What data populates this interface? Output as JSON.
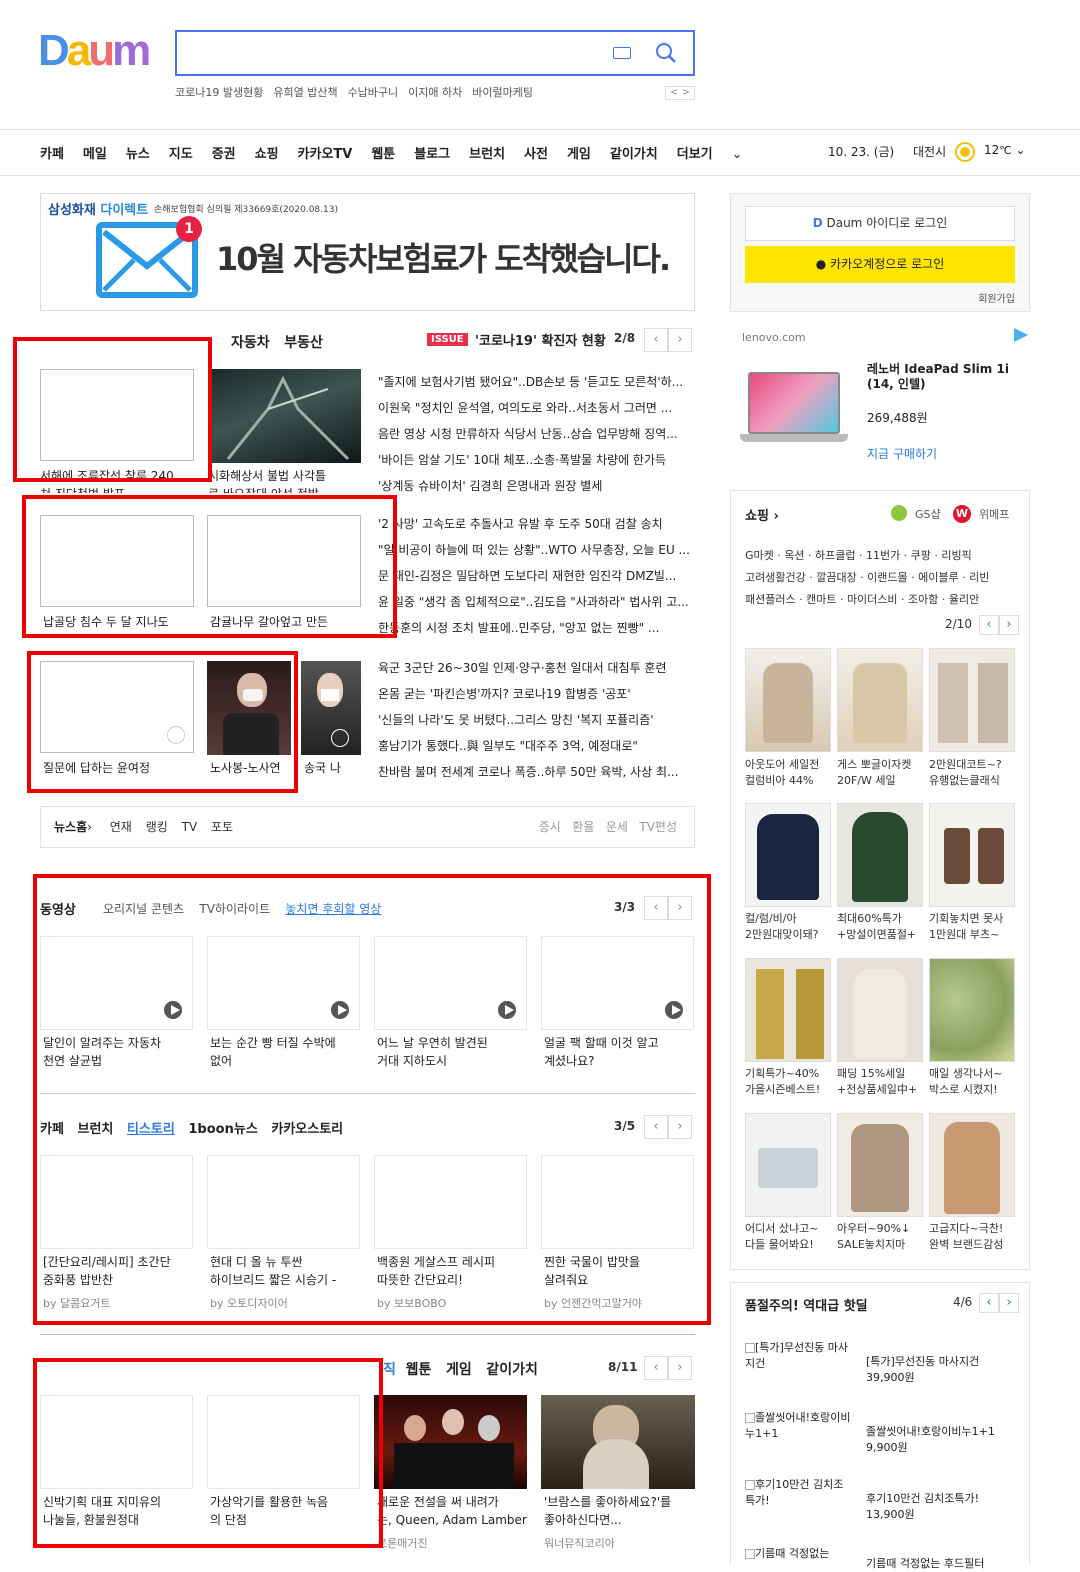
{
  "logo": "Daum",
  "header": {
    "keyword_icon": "keyboard-icon",
    "search_icon": "search-icon",
    "hot_keywords": [
      "코로나19 발생현황",
      "유희열 밥산책",
      "수납바구니",
      "이지애 하차",
      "바이럴마케팅"
    ],
    "pager_prev": "<",
    "pager_next": ">"
  },
  "nav": {
    "items": [
      "카페",
      "메일",
      "뉴스",
      "지도",
      "증권",
      "쇼핑",
      "카카오TV",
      "웹툰",
      "블로그",
      "브런치",
      "사전",
      "게임",
      "같이가치",
      "더보기"
    ],
    "date": "10. 23. (금)",
    "location": "대전시",
    "temp": "12",
    "temp_unit": "℃"
  },
  "ad": {
    "brand1": "삼성화재",
    "brand2": "다이렉트",
    "note": "손해보험협회 심의필 제33669호(2020.08.13)",
    "badge": "1",
    "headline": "10월 자동차보험료가 도착했습니다."
  },
  "news": {
    "tabs_partial": "자동차",
    "tab2": "부동산",
    "issue_badge": "ISSUE",
    "issue_text": "'코로나19' 확진자 현황",
    "issue_page": "2/8",
    "row1_caps": [
      "서해에 조류잡선 참루 240",
      "쳐 진단청법 발표",
      "시화해상서 불법 사각틀",
      "로 바오장대 야선 적발"
    ],
    "row2_caps": [
      "납골당 침수 두 달 지나도",
      "감귤나무 갈아엎고 만든"
    ],
    "row3_caps": [
      "질문에 답하는 윤여정",
      "노사봉-노사연",
      "송국 나"
    ],
    "list": [
      "\"졸지에 보험사기범 됐어요\"..DB손보 등 '듣고도 모른척'하...",
      "이원욱 \"정치인 윤석열, 여의도로 와라..서초동서 그러면 ...",
      "음란 영상 시청 만류하자 식당서 난동..상습 업무방해 징역...",
      "'바이든 암살 기도' 10대 체포..소총·폭발물 차량에 한가득",
      "'상계동 슈바이처' 김경희 은명내과 원장 별세",
      "'2 사망' 고속도로 추돌사고 유발 후 도주 50대 검찰 송치",
      "\"일 비공이 하늘에 떠 있는 상황\"..WTO 사무총장, 오늘 EU ...",
      "문 대인-김정은 밀담하면 도보다리 재현한 임진각 DMZ빌...",
      "윤 일중 \"생각 좀 입체적으로\"..김도읍 \"사과하라\" 법사위 고...",
      "한동훈의 시정 조치 발표에..민주당, \"앙꼬 없는 찐빵\" ...",
      "육군 3군단 26~30일 인제·양구·홍천 일대서 대침투 훈련",
      "온몸 굳는 '파킨슨병'까지? 코로나19 합병증 '공포'",
      "'신들의 나라'도 못 버텼다..그리스 망친 '복지 포퓰리즘'",
      "홍남기가 통했다..與 일부도 \"대주주 3억, 예정대로\"",
      "찬바람 불며 전세계 코로나 폭증..하루 50만 육박, 사상 최..."
    ],
    "bottom_tabs": [
      "뉴스홈",
      "연재",
      "랭킹",
      "TV",
      "포토"
    ],
    "bottom_right": [
      "증시",
      "환율",
      "운세",
      "TV편성"
    ]
  },
  "video": {
    "title": "동영상",
    "tabs": [
      "오리지널 콘텐츠",
      "TV하이라이트",
      "놓치면 후회할 영상"
    ],
    "page": "3/3",
    "items": [
      [
        "달인이 알려주는 자동차",
        "천연 살균법"
      ],
      [
        "보는 순간 빵 터질 수박에",
        "없어"
      ],
      [
        "어느 날 우연히 발견된",
        "거대 지하도시"
      ],
      [
        "얼굴 팩 할때 이것 알고",
        "계셨나요?"
      ]
    ]
  },
  "cafe": {
    "tabs": [
      "카페",
      "브런치",
      "티스토리",
      "1boon뉴스",
      "카카오스토리"
    ],
    "page": "3/5",
    "items": [
      {
        "l1": "[간단요리/레시피] 초간단",
        "l2": "중화풍 밥반찬",
        "by": "by 달콤요거트"
      },
      {
        "l1": "현대 디 올 뉴 투싼",
        "l2": "하이브리드 짧은 시승기 -",
        "by": "by 오토디자이어"
      },
      {
        "l1": "백종원 게살스프 레시피",
        "l2": "따뜻한 간단요리!",
        "by": "by 보보BOBO"
      },
      {
        "l1": "찐한 국물이 밥맛을",
        "l2": "살려줘요",
        "by": "by 언젠간먹고말거야"
      }
    ]
  },
  "bottom": {
    "tabs": [
      "직",
      "웹툰",
      "게임",
      "같이가치"
    ],
    "page": "8/11",
    "items": [
      [
        "신박기획 대표 지미유의",
        "나눌들, 환불원정대"
      ],
      [
        "가상악기를 활용한 녹음",
        "의 단점"
      ],
      [
        "새로운 전설을 써 내려가",
        "는, Queen, Adam Lambert"
      ],
      [
        "'브람스를 좋아하세요?'를",
        "좋아하신다면..."
      ]
    ],
    "bys": [
      "",
      "",
      "로론매거진",
      "워너뮤직코리아"
    ]
  },
  "login": {
    "daum": "Daum 아이디로 로그인",
    "kakao": "카카오계정으로 로그인",
    "join": "회원가입"
  },
  "right_ad": {
    "domain": "lenovo.com",
    "title1": "레노버 IdeaPad Slim 1i",
    "title2": "(14, 인텔)",
    "price": "269,488원",
    "cta": "지금 구매하기"
  },
  "shopping": {
    "title": "쇼핑",
    "gs": "GS샵",
    "wemep": "위메프",
    "links": [
      "G마켓 · 옥션 · 하프클럽 · 11번가 · 쿠팡 · 리빙픽",
      "고려생활건강 · 깔끔대장 · 이랜드몰 · 에이블루 · 리빈",
      "패션플러스 · 캔마트 · 마이더스비 · 조아함 · 율리안"
    ],
    "page": "2/10",
    "items": [
      [
        "아웃도어 세일전",
        "컬럼비아 44%"
      ],
      [
        "게스 뽀글이자켓",
        "20F/W 세일"
      ],
      [
        "2만원대코트~?",
        "유행없는클래식"
      ],
      [
        "컬/럼/비/아",
        "2만원대맞이돼?"
      ],
      [
        "최대60%특가",
        "+망설이면품절+"
      ],
      [
        "기회놓치면 못사",
        "1만원대 부츠~"
      ],
      [
        "기획특가~40%",
        "가을시즌베스트!"
      ],
      [
        "패딩 15%세일",
        "+전상품세일中+"
      ],
      [
        "매일 생각나서~",
        "박스로 시켰지!"
      ],
      [
        "어디서 샀냐고~",
        "다들 물어봐요!"
      ],
      [
        "아우터~90%↓",
        "SALE놓치지마"
      ],
      [
        "고급지다~극찬!",
        "완벽 브랜드감성"
      ]
    ]
  },
  "hotdeal": {
    "title": "품절주의! 역대급 핫딜",
    "page": "4/6",
    "items": [
      {
        "alt": "[특가]무선진동 마사지건",
        "name": "[특가]무선진동 마사지건",
        "price": "39,900원"
      },
      {
        "alt": "졸쌀씻어내!호랑이비누1+1",
        "name": "졸쌀씻어내!호랑이비누1+1",
        "price": "9,900원"
      },
      {
        "alt": "후기10만건 김치조특가!",
        "name": "후기10만건 김치조특가!",
        "price": "13,900원"
      },
      {
        "alt": "기름때 걱정없는",
        "name": "기름때 걱정없는 후드필터",
        "price": ""
      }
    ]
  },
  "colors": {
    "accent": "#4a72f3",
    "kakao": "#fee500",
    "red": "#e00000"
  }
}
